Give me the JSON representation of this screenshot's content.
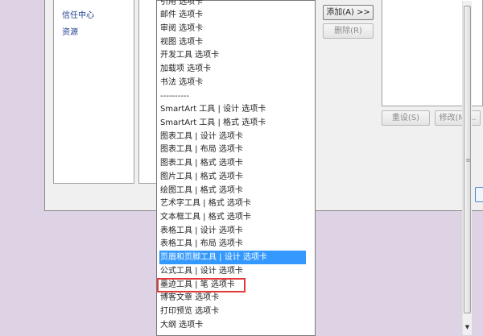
{
  "left_nav": {
    "items": [
      {
        "label": "信任中心"
      },
      {
        "label": "资源"
      }
    ]
  },
  "buttons": {
    "add": "添加(A) >>",
    "remove": "删除(R)",
    "reset": "重设(S)",
    "modify": "修改(M)..."
  },
  "dropdown": {
    "items": [
      {
        "label": "引用 选项卡"
      },
      {
        "label": "邮件 选项卡"
      },
      {
        "label": "审阅 选项卡"
      },
      {
        "label": "视图 选项卡"
      },
      {
        "label": "开发工具 选项卡"
      },
      {
        "label": "加载项 选项卡"
      },
      {
        "label": "书法 选项卡"
      },
      {
        "label": "----------"
      },
      {
        "label": "SmartArt 工具 | 设计 选项卡"
      },
      {
        "label": "SmartArt 工具 | 格式 选项卡"
      },
      {
        "label": "图表工具 | 设计 选项卡"
      },
      {
        "label": "图表工具 | 布局 选项卡"
      },
      {
        "label": "图表工具 | 格式 选项卡"
      },
      {
        "label": "图片工具 | 格式 选项卡"
      },
      {
        "label": "绘图工具 | 格式 选项卡"
      },
      {
        "label": "艺术字工具 | 格式 选项卡"
      },
      {
        "label": "文本框工具 | 格式 选项卡"
      },
      {
        "label": "表格工具 | 设计 选项卡"
      },
      {
        "label": "表格工具 | 布局 选项卡"
      },
      {
        "label": "页眉和页脚工具 | 设计 选项卡"
      },
      {
        "label": "公式工具 | 设计 选项卡"
      },
      {
        "label": "墨迹工具 | 笔 选项卡"
      },
      {
        "label": "博客文章 选项卡"
      },
      {
        "label": "打印预览 选项卡"
      },
      {
        "label": "大纲 选项卡"
      }
    ],
    "selected_label": "页眉和页脚工具 | 设计 选项卡",
    "highlighted_label": "墨迹工具 | 笔 选项卡"
  },
  "icons": {
    "scroll_down": "scroll-down-arrow-icon",
    "scroll_grip": "scroll-grip-icon"
  },
  "colors": {
    "selection": "#3399ff",
    "highlight_outline": "#e23a3a",
    "link_text": "#1f3e8e"
  }
}
